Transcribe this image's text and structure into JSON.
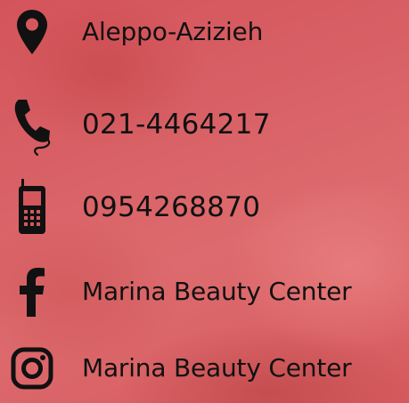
{
  "contacts": [
    {
      "icon": "location-pin-icon",
      "text": "Aleppo-Azizieh"
    },
    {
      "icon": "telephone-handset-icon",
      "text": "021-4464217"
    },
    {
      "icon": "mobile-phone-icon",
      "text": "0954268870"
    },
    {
      "icon": "facebook-icon",
      "text": "Marina Beauty Center"
    },
    {
      "icon": "instagram-icon",
      "text": "Marina Beauty Center"
    }
  ],
  "colors": {
    "background": "#d85f63",
    "foreground": "#111111"
  }
}
